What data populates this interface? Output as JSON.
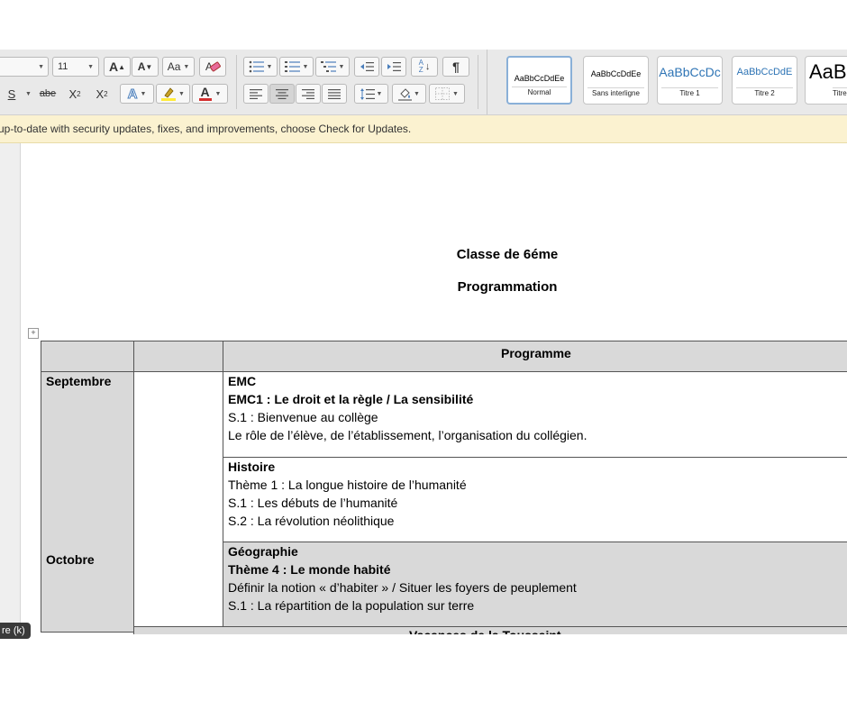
{
  "toolbar": {
    "font_size": "11",
    "grow_font_label": "A",
    "shrink_font_label": "A",
    "change_case_label": "Aa",
    "underline_label": "S",
    "strikethrough_label": "abe",
    "subscript_label": "X",
    "subscript_mark": "2",
    "superscript_label": "X",
    "superscript_mark": "2",
    "text_effects_label": "A",
    "font_color_label": "A",
    "font_color": "#d32f2f",
    "highlight_color": "#ffeb3b",
    "accent_color": "#4a7ebb",
    "show_formatting_symbol": "¶",
    "sort_label_top": "A",
    "sort_label_bottom": "Z",
    "styles": [
      {
        "sample": "AaBbCcDdEe",
        "name": "Normal"
      },
      {
        "sample": "AaBbCcDdEe",
        "name": "Sans interligne"
      },
      {
        "sample": "AaBbCcDc",
        "name": "Titre 1"
      },
      {
        "sample": "AaBbCcDdE",
        "name": "Titre 2"
      },
      {
        "sample": "AaB",
        "name": "Titre"
      }
    ]
  },
  "message_bar": {
    "text": "up-to-date with security updates, fixes, and improvements, choose Check for Updates."
  },
  "document": {
    "title": "Classe de 6éme",
    "subtitle": "Programmation",
    "table": {
      "header_programme": "Programme",
      "months": [
        "Septembre",
        "Octobre"
      ],
      "blocks": [
        {
          "lines": [
            {
              "text": "EMC",
              "bold": true
            },
            {
              "text": "EMC1 : Le droit et la règle / La sensibilité",
              "bold": true
            },
            {
              "text": "S.1 : Bienvenue au collège",
              "bold": false
            },
            {
              "text": "Le rôle de l’élève, de l’établissement, l’organisation du collégien.",
              "bold": false
            }
          ]
        },
        {
          "lines": [
            {
              "text": "Histoire",
              "bold": true
            },
            {
              "text": "Thème 1 : La longue histoire de l’humanité",
              "bold": false
            },
            {
              "text": "S.1 : Les débuts de l’humanité",
              "bold": false
            },
            {
              "text": "S.2 : La révolution néolithique",
              "bold": false
            }
          ]
        },
        {
          "lines": [
            {
              "text": "Géographie",
              "bold": true
            },
            {
              "text": "Thème 4 : Le monde habité",
              "bold": true
            },
            {
              "text": "Définir la notion « d’habiter » / Situer les foyers de peuplement",
              "bold": false
            },
            {
              "text": "S.1 : La répartition de la population sur terre",
              "bold": false
            }
          ]
        }
      ],
      "vacation_row": "Vacances de la Toussaint"
    }
  },
  "hover_badge": "re (k)"
}
